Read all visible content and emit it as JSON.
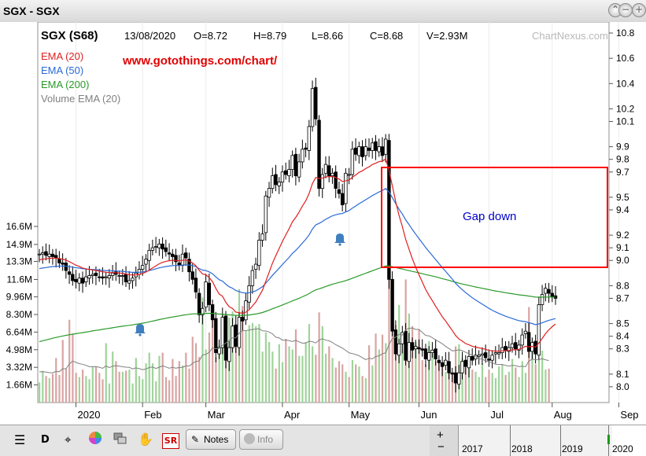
{
  "window": {
    "title": "SGX - SGX"
  },
  "header": {
    "symbol": "SGX (S68)",
    "date": "13/08/2020",
    "open": "O=8.72",
    "high": "H=8.79",
    "low": "L=8.66",
    "close": "C=8.68",
    "volume": "V=2.93M",
    "watermark": "ChartNexus.com",
    "url": "www.gotothings.com/chart/"
  },
  "legend": [
    {
      "label": "EMA (20)",
      "color": "#e02020"
    },
    {
      "label": "EMA (50)",
      "color": "#2a6ad6"
    },
    {
      "label": "EMA (200)",
      "color": "#2a9a2a"
    },
    {
      "label": "Volume EMA (20)",
      "color": "#808080"
    }
  ],
  "annotation": {
    "label": "Gap down",
    "color": "#ff0000",
    "text_color": "#0000cc"
  },
  "toolbar": {
    "d_label": "D",
    "sr_label": "SR",
    "notes_label": "Notes",
    "info_label": "Info",
    "nav_years": [
      "2017",
      "2018",
      "2019",
      "2020"
    ]
  },
  "chart_data": {
    "type": "candlestick",
    "title": "SGX (S68)",
    "x_ticks": [
      "2020",
      "Feb",
      "Mar",
      "Apr",
      "May",
      "Jun",
      "Jul",
      "Aug",
      "Sep"
    ],
    "price_ticks": [
      "10.8",
      "10.6",
      "10.4",
      "10.2",
      "10.1",
      "9.9",
      "9.8",
      "9.7",
      "9.5",
      "9.4",
      "9.2",
      "9.1",
      "9.0",
      "8.8",
      "8.7",
      "8.5",
      "8.4",
      "8.3",
      "8.1",
      "8.0"
    ],
    "volume_ticks": [
      "16.6M",
      "14.9M",
      "13.3M",
      "11.6M",
      "9.96M",
      "8.30M",
      "6.64M",
      "4.98M",
      "3.32M",
      "1.66M"
    ],
    "price_range": [
      7.9,
      10.8
    ],
    "volume_range": [
      0,
      16.6
    ],
    "close": [
      9.05,
      9.06,
      9.04,
      9.05,
      9.03,
      9.02,
      8.98,
      8.97,
      8.92,
      8.89,
      8.84,
      8.83,
      8.86,
      8.82,
      8.87,
      8.88,
      8.89,
      8.88,
      8.87,
      8.86,
      8.87,
      8.88,
      8.9,
      8.89,
      8.88,
      8.88,
      8.83,
      8.84,
      8.86,
      8.9,
      8.93,
      8.96,
      9.01,
      9.08,
      9.1,
      9.11,
      9.13,
      9.09,
      9.07,
      9.05,
      9.03,
      8.99,
      8.96,
      9.05,
      9.02,
      8.91,
      8.85,
      8.75,
      8.57,
      8.62,
      8.83,
      8.65,
      8.53,
      8.27,
      8.31,
      8.55,
      8.21,
      8.31,
      8.48,
      8.32,
      8.55,
      8.52,
      8.68,
      8.8,
      8.92,
      8.97,
      9.16,
      9.21,
      9.51,
      9.57,
      9.67,
      9.6,
      9.62,
      9.7,
      9.68,
      9.72,
      9.83,
      9.67,
      9.78,
      9.88,
      9.88,
      10.06,
      10.36,
      10.12,
      9.57,
      9.68,
      9.76,
      9.67,
      9.69,
      9.57,
      9.53,
      9.44,
      9.69,
      9.68,
      9.88,
      9.84,
      9.9,
      9.82,
      9.9,
      9.87,
      9.93,
      9.87,
      9.9,
      9.83,
      9.96,
      8.85,
      8.44,
      8.26,
      8.34,
      8.43,
      8.21,
      8.35,
      8.29,
      8.32,
      8.3,
      8.29,
      8.22,
      8.27,
      8.29,
      8.22,
      8.19,
      8.16,
      8.21,
      8.11,
      8.1,
      8.03,
      8.11,
      8.2,
      8.16,
      8.24,
      8.21,
      8.25,
      8.25,
      8.26,
      8.23,
      8.21,
      8.25,
      8.27,
      8.27,
      8.31,
      8.29,
      8.31,
      8.34,
      8.3,
      8.33,
      8.41,
      8.44,
      8.28,
      8.35,
      8.26,
      8.65,
      8.73,
      8.78,
      8.74,
      8.71,
      8.7
    ],
    "ema20_end": 8.49,
    "ema50_end": 8.52,
    "ema200_end": 8.74,
    "volume_m": [
      1.9,
      3.0,
      2.5,
      2.3,
      2.7,
      4.2,
      2.6,
      5.9,
      3.2,
      7.8,
      6.5,
      2.8,
      2.4,
      3.1,
      2.5,
      2.2,
      3.4,
      3.4,
      2.8,
      2.2,
      5.6,
      1.8,
      4.8,
      3.9,
      2.9,
      2.9,
      3.0,
      3.1,
      1.8,
      4.2,
      2.5,
      2.2,
      3.7,
      4.7,
      3.7,
      2.0,
      4.4,
      4.7,
      2.4,
      2.1,
      4.1,
      2.5,
      3.9,
      3.5,
      4.7,
      3.2,
      6.2,
      5.6,
      4.3,
      9.9,
      5.0,
      6.6,
      9.1,
      4.3,
      5.4,
      8.3,
      7.6,
      8.0,
      8.6,
      6.0,
      10.7,
      9.1,
      6.8,
      7.3,
      7.5,
      7.2,
      7.4,
      4.8,
      6.6,
      5.7,
      4.8,
      3.2,
      5.5,
      3.8,
      6.0,
      5.3,
      5.0,
      6.9,
      4.4,
      4.4,
      5.7,
      7.4,
      5.3,
      4.5,
      8.5,
      7.2,
      4.6,
      5.3,
      4.2,
      3.3,
      3.9,
      3.6,
      2.9,
      2.4,
      4.0,
      3.6,
      3.4,
      2.5,
      2.3,
      5.4,
      3.5,
      6.5,
      5.0,
      6.4,
      5.6,
      12.9,
      11.4,
      7.3,
      9.2,
      5.5,
      11.6,
      8.4,
      7.2,
      5.7,
      6.9,
      4.0,
      3.6,
      5.8,
      4.6,
      3.9,
      4.0,
      3.8,
      2.9,
      3.2,
      2.7,
      5.3,
      5.5,
      4.2,
      3.3,
      3.3,
      3.1,
      2.9,
      2.4,
      3.7,
      2.4,
      3.1,
      2.8,
      2.3,
      3.4,
      3.6,
      2.6,
      2.9,
      4.1,
      3.3,
      2.4,
      3.9,
      2.8,
      9.0,
      5.8,
      3.6,
      4.1,
      4.9,
      3.1,
      3.2
    ],
    "gap_box": {
      "from": 9.82,
      "to": 9.02,
      "label": "Gap down"
    }
  }
}
